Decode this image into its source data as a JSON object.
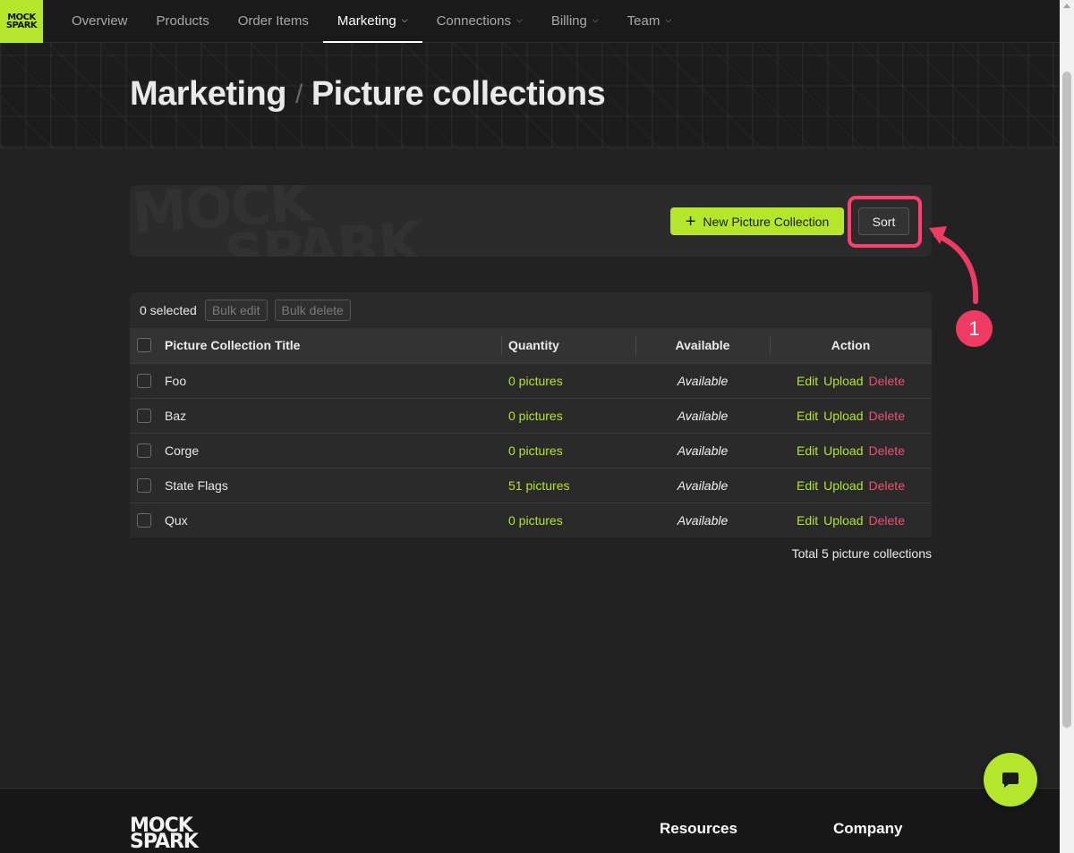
{
  "brand": {
    "logo_line1": "MOCK",
    "logo_line2": "SPARK",
    "accent": "#b4e62b",
    "danger": "#f0506e",
    "annotation": "#ff3e6c"
  },
  "nav": {
    "items": [
      {
        "label": "Overview",
        "dropdown": false,
        "active": false
      },
      {
        "label": "Products",
        "dropdown": false,
        "active": false
      },
      {
        "label": "Order Items",
        "dropdown": false,
        "active": false
      },
      {
        "label": "Marketing",
        "dropdown": true,
        "active": true
      },
      {
        "label": "Connections",
        "dropdown": true,
        "active": false
      },
      {
        "label": "Billing",
        "dropdown": true,
        "active": false
      },
      {
        "label": "Team",
        "dropdown": true,
        "active": false
      }
    ]
  },
  "hero": {
    "section": "Marketing",
    "separator": "/",
    "page": "Picture collections"
  },
  "toolbar": {
    "watermark_line1": "MOCK",
    "watermark_line2": "SPARK",
    "new_label": "New Picture Collection",
    "new_icon": "plus-icon",
    "sort_label": "Sort"
  },
  "annotation": {
    "step": "1"
  },
  "bulk": {
    "selected": "0 selected",
    "edit_label": "Bulk edit",
    "delete_label": "Bulk delete"
  },
  "table": {
    "headers": {
      "title": "Picture Collection Title",
      "quantity": "Quantity",
      "available": "Available",
      "action": "Action"
    },
    "actions": {
      "edit": "Edit",
      "upload": "Upload",
      "delete": "Delete"
    },
    "rows": [
      {
        "title": "Foo",
        "quantity": "0 pictures",
        "available": "Available"
      },
      {
        "title": "Baz",
        "quantity": "0 pictures",
        "available": "Available"
      },
      {
        "title": "Corge",
        "quantity": "0 pictures",
        "available": "Available"
      },
      {
        "title": "State Flags",
        "quantity": "51 pictures",
        "available": "Available"
      },
      {
        "title": "Qux",
        "quantity": "0 pictures",
        "available": "Available"
      }
    ],
    "total": "Total 5 picture collections"
  },
  "footer": {
    "logo_line1": "MOCK",
    "logo_line2": "SPARK",
    "col1": "Resources",
    "col2": "Company"
  },
  "chat": {
    "icon": "chat-icon"
  }
}
